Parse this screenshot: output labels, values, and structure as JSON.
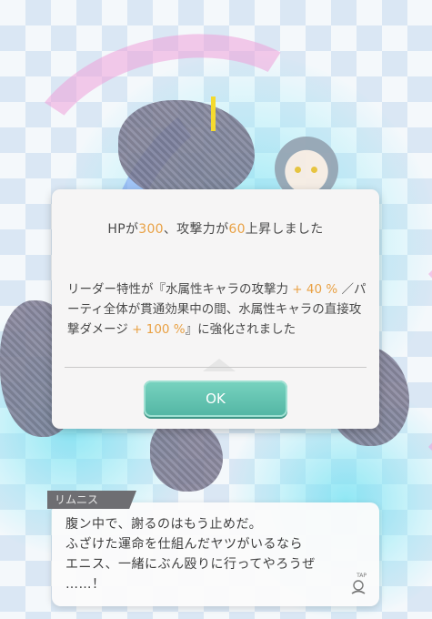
{
  "dialog": {
    "msg1": {
      "prefix": "HPが",
      "hp": "300",
      "mid": "、攻撃力が",
      "atk": "60",
      "suffix": "上昇しました"
    },
    "msg2": {
      "part1": "リーダー特性が『水属性キャラの攻撃力 ",
      "val1": "+ 40 %",
      "part2": " ／パーティ全体が貫通効果中の間、水属性キャラの直接攻撃ダメージ ",
      "val2": "+ 100 %",
      "part3": "』に強化されました"
    },
    "ok_label": "OK"
  },
  "speech": {
    "speaker": "リムニス",
    "lines": [
      "腹ン中で、謝るのはもう止めだ。",
      "ふざけた運命を仕組んだヤツがいるなら",
      "エニス、一緒にぶん殴りに行ってやろうぜ",
      "……！"
    ],
    "tap_label": "TAP"
  },
  "colors": {
    "accent_orange": "#e9a144",
    "ok_button": "#5fc0ae"
  }
}
